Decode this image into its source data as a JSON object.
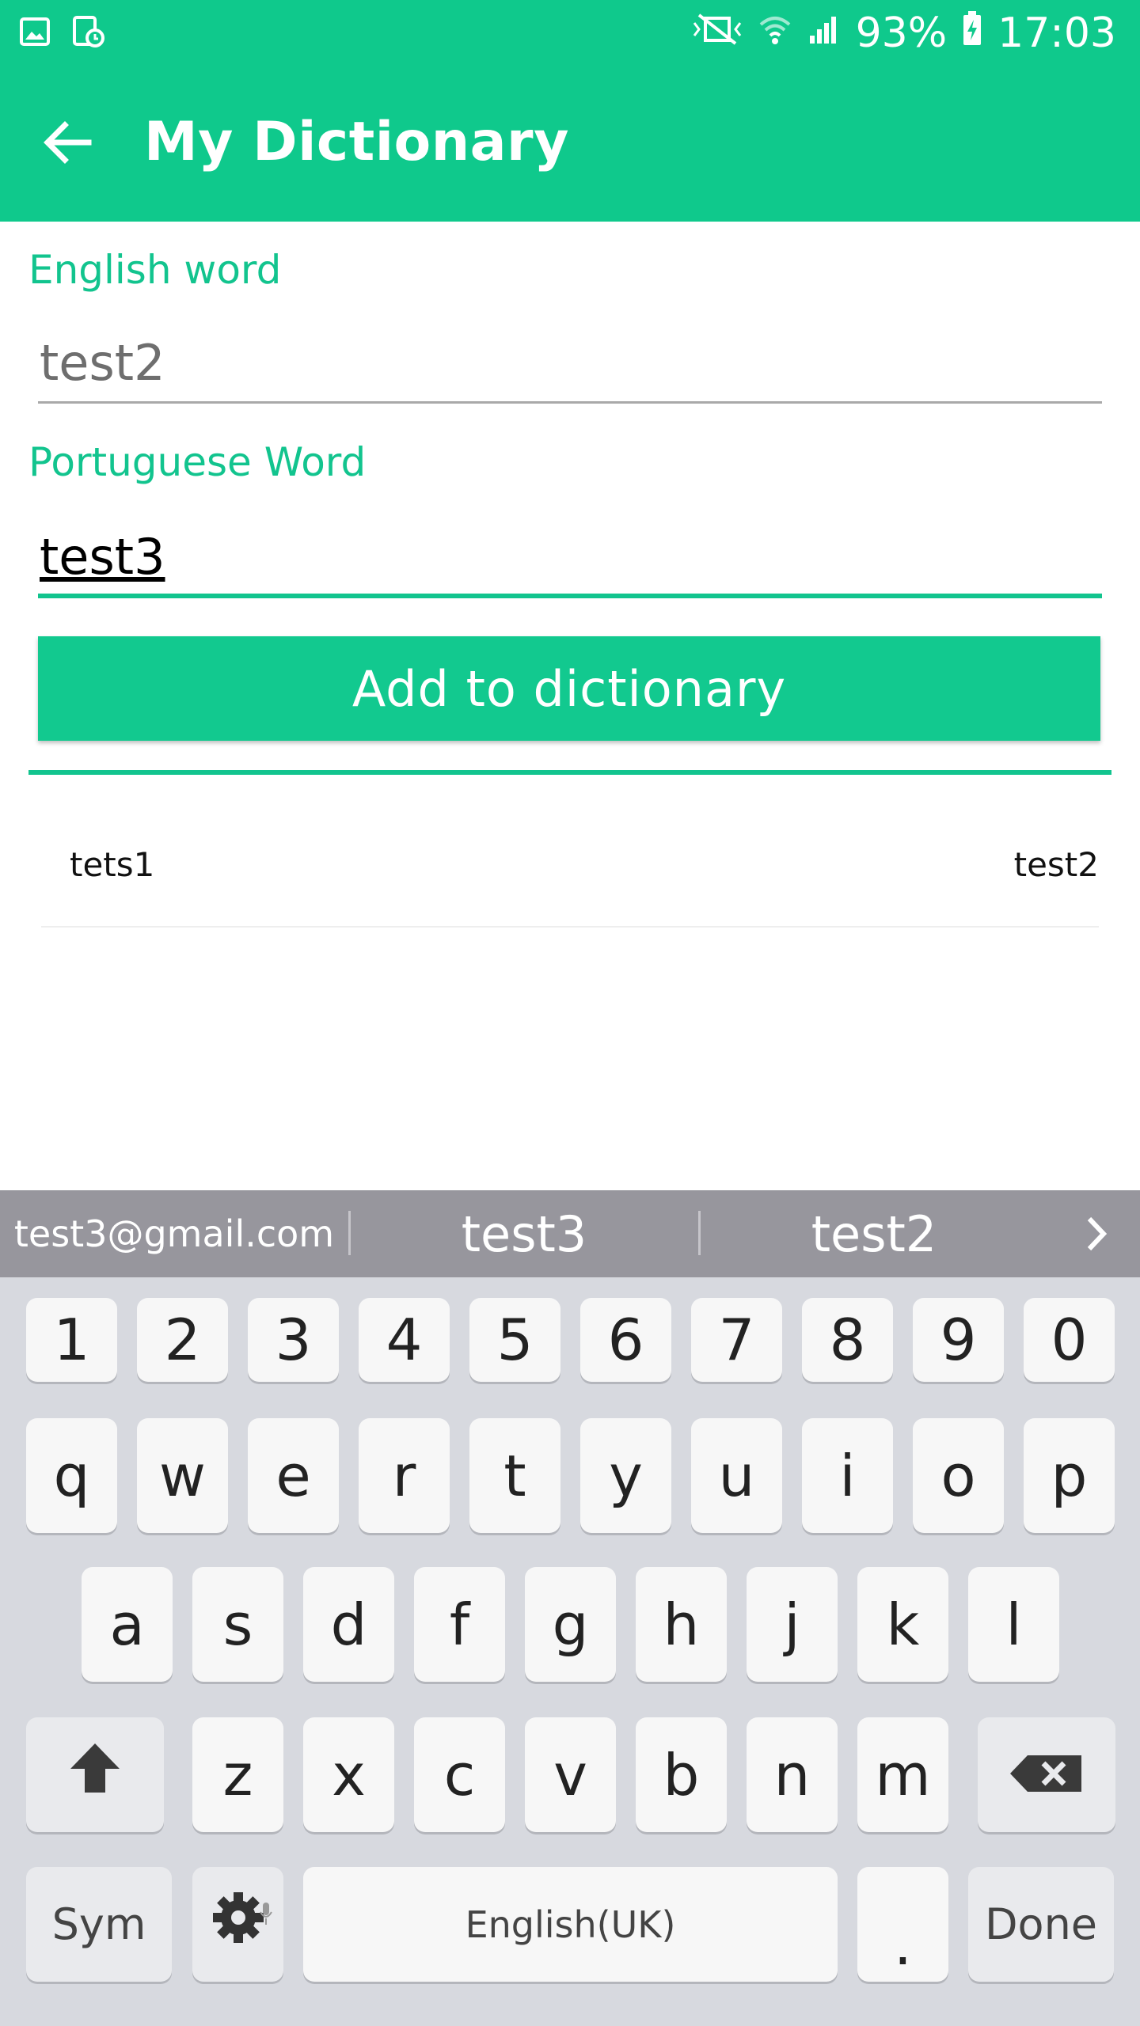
{
  "status_bar": {
    "battery": "93%",
    "time": "17:03",
    "icons": [
      "gallery-icon",
      "screenshot-icon",
      "mute-icon",
      "wifi-icon",
      "signal-icon",
      "battery-charging-icon"
    ]
  },
  "app_bar": {
    "title": "My Dictionary",
    "back_icon": "arrow-back-icon"
  },
  "form": {
    "english_label": "English word",
    "english_value": "test2",
    "portuguese_label": "Portuguese Word",
    "portuguese_value": "test3",
    "add_button": "Add to dictionary"
  },
  "entries": [
    {
      "english": "tets1",
      "portuguese": "test2"
    }
  ],
  "keyboard": {
    "suggestions": [
      "test3@gmail.com",
      "test3",
      "test2"
    ],
    "row_numbers": [
      "1",
      "2",
      "3",
      "4",
      "5",
      "6",
      "7",
      "8",
      "9",
      "0"
    ],
    "row_1": [
      "q",
      "w",
      "e",
      "r",
      "t",
      "y",
      "u",
      "i",
      "o",
      "p"
    ],
    "row_2": [
      "a",
      "s",
      "d",
      "f",
      "g",
      "h",
      "j",
      "k",
      "l"
    ],
    "row_3": [
      "z",
      "x",
      "c",
      "v",
      "b",
      "n",
      "m"
    ],
    "sym": "Sym",
    "space": "English(UK)",
    "period": ".",
    "done": "Done"
  },
  "colors": {
    "accent": "#0fc98c",
    "keyboard_bg": "#d7d9df",
    "suggestion_bar": "#97969d"
  }
}
